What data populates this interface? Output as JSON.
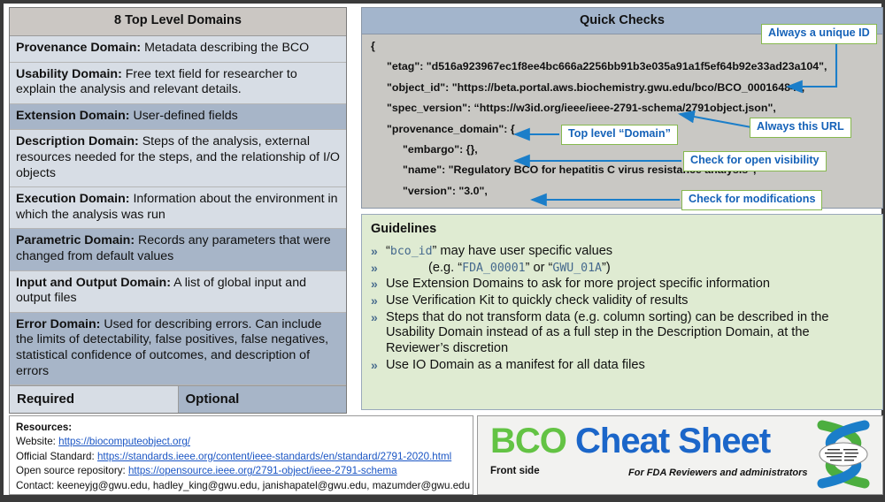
{
  "domains_table": {
    "title": "8 Top Level Domains",
    "rows": [
      {
        "term": "Provenance Domain:",
        "text": " Metadata describing the BCO",
        "shade": "light"
      },
      {
        "term": "Usability Domain:",
        "text": " Free text field for researcher to explain the analysis and relevant details.",
        "shade": "light"
      },
      {
        "term": "Extension Domain:",
        "text": " User-defined fields",
        "shade": "dark"
      },
      {
        "term": "Description Domain:",
        "text": " Steps of the analysis, external resources needed for the steps, and the relationship of I/O objects",
        "shade": "light"
      },
      {
        "term": "Execution Domain:",
        "text": " Information about the environment in which the analysis was run",
        "shade": "light"
      },
      {
        "term": "Parametric Domain:",
        "text": " Records any parameters that were changed from default values",
        "shade": "dark"
      },
      {
        "term": "Input and Output Domain:",
        "text": " A list of global input and output files",
        "shade": "light"
      },
      {
        "term": "Error Domain:",
        "text": " Used for describing errors. Can include the limits of detectability, false positives, false negatives, statistical confidence of outcomes, and description of errors",
        "shade": "dark"
      }
    ],
    "legend": {
      "required": "Required",
      "optional": "Optional"
    }
  },
  "quick_checks": {
    "title": "Quick Checks",
    "json_lines": [
      {
        "indent": 0,
        "text": "{"
      },
      {
        "indent": 1,
        "text": "\"etag\": \"d516a923967ec1f8ee4bc666a2256bb91b3e035a91a1f5ef64b92e33ad23a104\","
      },
      {
        "indent": 1,
        "text": "\"object_id\": \"https://beta.portal.aws.biochemistry.gwu.edu/bco/BCO_00016484\","
      },
      {
        "indent": 1,
        "text": "\"spec_version\": “https://w3id.org/ieee/ieee-2791-schema/2791object.json\","
      },
      {
        "indent": 1,
        "text": "\"provenance_domain\": {"
      },
      {
        "indent": 2,
        "text": "\"embargo\": {},"
      },
      {
        "indent": 2,
        "text": "\"name\": \"Regulatory BCO for hepatitis C virus resistance analysis\","
      },
      {
        "indent": 2,
        "text": "\"version\": \"3.0\","
      }
    ],
    "callouts": [
      {
        "label": "Always a unique ID"
      },
      {
        "label": "Always this URL"
      },
      {
        "label": "Top level “Domain”"
      },
      {
        "label": "Check for open visibility"
      },
      {
        "label": "Check for modifications"
      }
    ]
  },
  "guidelines": {
    "title": "Guidelines",
    "bullet": "»",
    "items": [
      {
        "pre": "“",
        "code": "bco_id",
        "post": "” may have user specific values",
        "indent": false
      },
      {
        "pre": "(e.g. “",
        "code": "FDA_00001",
        "mid": "” or “",
        "code2": "GWU_01A",
        "post": "”)",
        "indent": true
      },
      {
        "pre": "",
        "post": "Use Extension Domains to ask for more project specific information",
        "indent": false
      },
      {
        "pre": "",
        "post": "Use Verification Kit to quickly check validity of results",
        "indent": false
      },
      {
        "pre": "",
        "post": "Steps that do not transform data (e.g. column sorting) can be described in the Usability Domain instead of as a full step in the Description Domain, at the Reviewer’s discretion",
        "indent": false
      },
      {
        "pre": "",
        "post": "Use IO Domain as a manifest for all data files",
        "indent": false
      }
    ]
  },
  "resources": {
    "title": "Resources:",
    "website_label": "Website: ",
    "website_url": "https://biocomputeobject.org/",
    "standard_label": "Official Standard: ",
    "standard_url": "https://standards.ieee.org/content/ieee-standards/en/standard/2791-2020.html",
    "repo_label": "Open source repository: ",
    "repo_url": "https://opensource.ieee.org/2791-object/ieee-2791-schema",
    "contact": "Contact: keeneyjg@gwu.edu, hadley_king@gwu.edu, janishapatel@gwu.edu, mazumder@gwu.edu"
  },
  "brand": {
    "bco": "BCO",
    "cheat_sheet": "Cheat Sheet",
    "front_side": "Front side",
    "subtitle": "For FDA Reviewers and administrators"
  },
  "colors": {
    "accent_green": "#86b84e",
    "accent_blue": "#1562b8",
    "row_light": "#d7dde5",
    "row_dark": "#a7b5c8",
    "guidelines_bg": "#dfebd2",
    "brand_green": "#63c344",
    "brand_blue": "#1b66c9"
  }
}
